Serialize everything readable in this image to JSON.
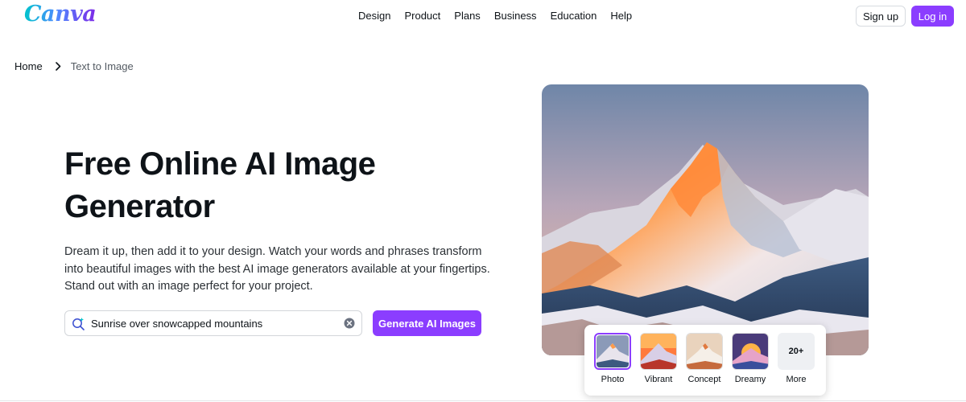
{
  "brand": {
    "logo_text": "Canva",
    "accent": "#8b3dff"
  },
  "nav": {
    "items": [
      "Design",
      "Product",
      "Plans",
      "Business",
      "Education",
      "Help"
    ]
  },
  "auth": {
    "signup_label": "Sign up",
    "login_label": "Log in"
  },
  "breadcrumb": {
    "home": "Home",
    "current": "Text to Image"
  },
  "hero": {
    "title_line1": "Free Online AI Image",
    "title_line2": "Generator",
    "description": "Dream it up, then add it to your design. Watch your words and phrases transform into beautiful images with the best AI image generators available at your fingertips. Stand out with an image perfect for your project."
  },
  "search": {
    "value": "Sunrise over snowcapped mountains",
    "icon": "magic-search-icon",
    "clear_icon": "clear-icon"
  },
  "generate_button": {
    "label": "Generate AI Images"
  },
  "style_picker": {
    "options": [
      {
        "label": "Photo",
        "selected": true
      },
      {
        "label": "Vibrant",
        "selected": false
      },
      {
        "label": "Concept",
        "selected": false
      },
      {
        "label": "Dreamy",
        "selected": false
      },
      {
        "label": "More",
        "badge": "20+",
        "selected": false
      }
    ]
  }
}
